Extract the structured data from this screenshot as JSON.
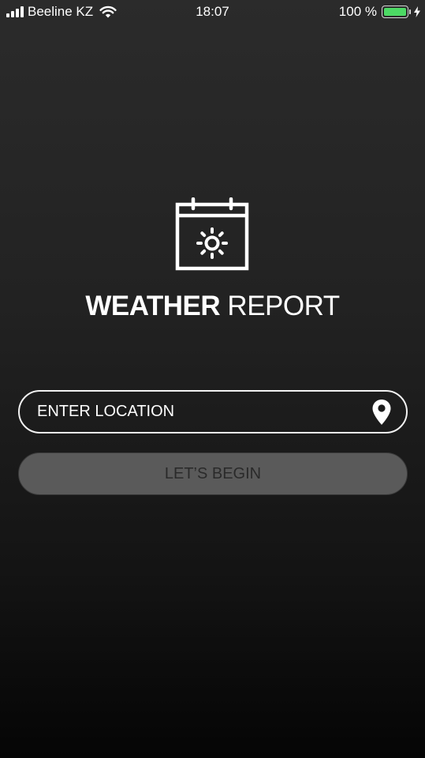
{
  "status_bar": {
    "carrier": "Beeline KZ",
    "time": "18:07",
    "battery_percent": "100 %",
    "signal_icon": "signal-bars-icon",
    "wifi_icon": "wifi-icon",
    "battery_icon": "battery-icon",
    "charging_icon": "charging-bolt-icon",
    "battery_color": "#4cd964"
  },
  "logo": {
    "icon": "calendar-sun-icon",
    "title_bold": "WEATHER",
    "title_light": "REPORT"
  },
  "location": {
    "placeholder": "ENTER LOCATION",
    "value": "",
    "icon": "location-pin-icon"
  },
  "begin_button": {
    "label": "LET’S BEGIN",
    "enabled": false
  },
  "colors": {
    "background_top": "#2b2b2b",
    "background_bottom": "#050505",
    "button_bg": "#5a5a5a",
    "button_text": "#2a2a2a",
    "text": "#ffffff"
  }
}
